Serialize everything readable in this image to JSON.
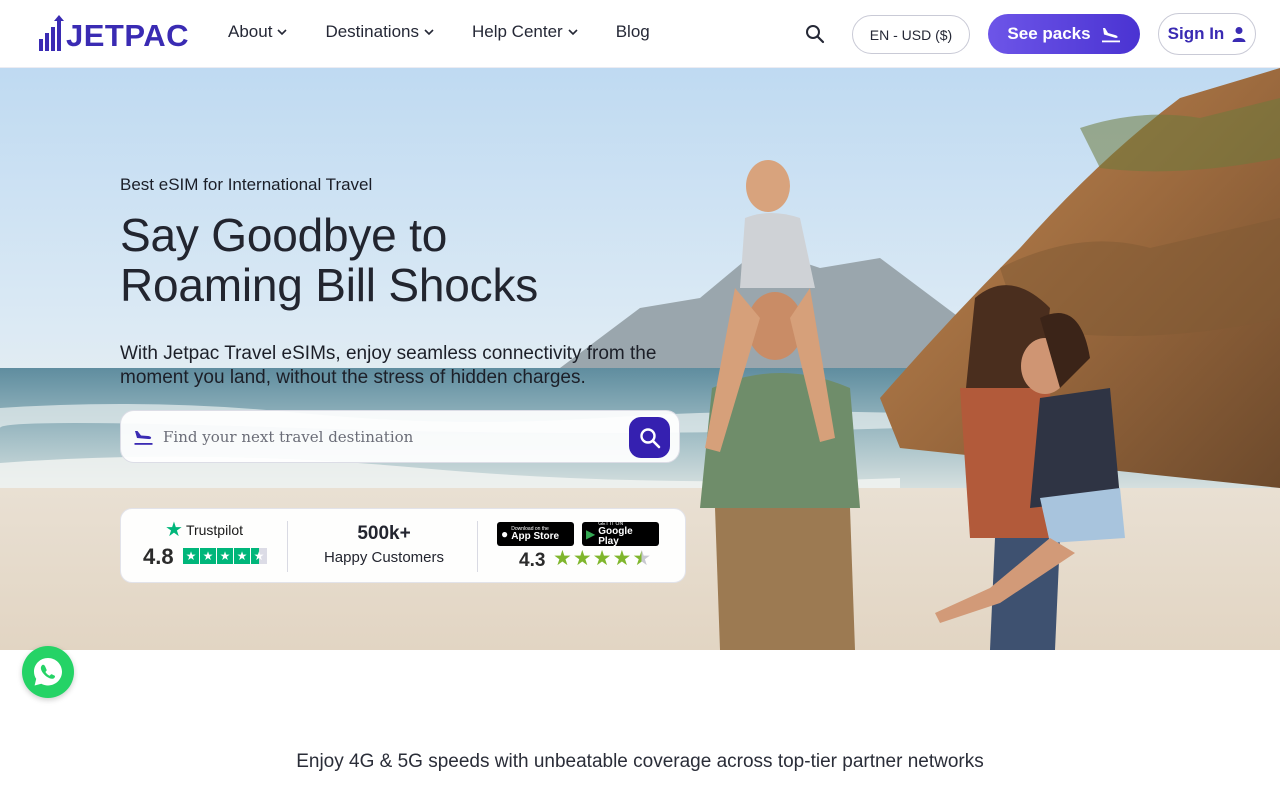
{
  "header": {
    "logo_text": "JETPAC",
    "nav": [
      {
        "label": "About",
        "has_dropdown": true
      },
      {
        "label": "Destinations",
        "has_dropdown": true
      },
      {
        "label": "Help Center",
        "has_dropdown": true
      },
      {
        "label": "Blog",
        "has_dropdown": false
      }
    ],
    "search_icon": "search-icon",
    "locale_label": "EN - USD ($)",
    "see_packs_label": "See packs",
    "sign_in_label": "Sign In"
  },
  "hero": {
    "eyebrow": "Best eSIM for International Travel",
    "headline_line1": "Say Goodbye to",
    "headline_line2": "Roaming Bill Shocks",
    "subtext": "With Jetpac Travel eSIMs, enjoy seamless connectivity from the moment you land, without the stress of hidden charges.",
    "search_placeholder": "Find your next travel destination",
    "trust": {
      "trustpilot_label": "Trustpilot",
      "trustpilot_rating": "4.8",
      "trustpilot_stars": 4.5,
      "customers_count": "500k+",
      "customers_label": "Happy Customers",
      "app_store_small": "Download on the",
      "app_store_big": "App Store",
      "google_play_small": "GET IT ON",
      "google_play_big": "Google Play",
      "app_rating": "4.3",
      "app_stars": 4.5
    }
  },
  "section": {
    "coverage_text": "Enjoy 4G & 5G speeds with unbeatable coverage across top-tier partner networks"
  },
  "colors": {
    "brand": "#3a2bb3",
    "cta_start": "#6d55e8",
    "cta_end": "#4a33d2",
    "trustpilot_green": "#00b67a",
    "app_star_green": "#7fb62c",
    "whatsapp_green": "#25d366"
  }
}
